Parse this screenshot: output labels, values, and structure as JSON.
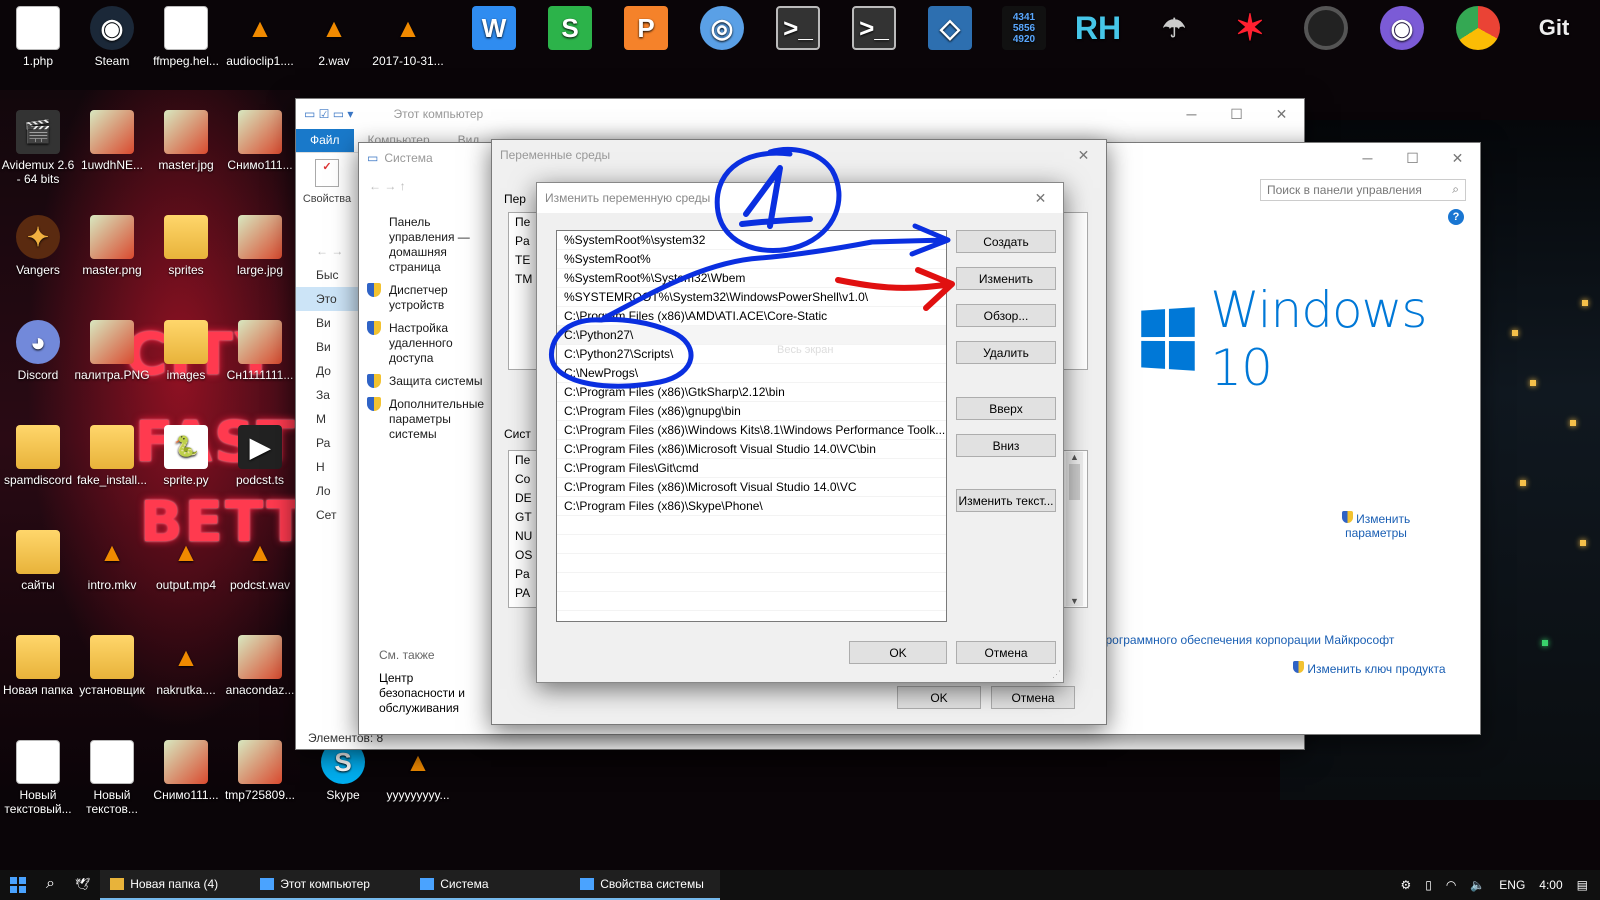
{
  "desktop": {
    "top_row": [
      {
        "label": "1.php",
        "icon": "file-icon"
      },
      {
        "label": "Steam",
        "icon": "steam-icon"
      },
      {
        "label": "ffmpeg.hel...",
        "icon": "file-icon"
      },
      {
        "label": "audioclip1....",
        "icon": "vlc-icon"
      },
      {
        "label": "2.wav",
        "icon": "vlc-icon"
      },
      {
        "label": "2017-10-31...",
        "icon": "vlc-icon"
      }
    ],
    "dock_icons": [
      "wps-writer-icon",
      "wps-spreadsheet-icon",
      "wps-presentation-icon",
      "settings-icon",
      "terminal-icon",
      "terminal-icon",
      "virtualbox-icon",
      "calculator-icon",
      "rh-icon",
      "network-icon",
      "star-icon",
      "obs-icon",
      "github-icon",
      "chrome-icon",
      "git-icon"
    ],
    "dock_text": {
      "calc": "4341\n5856\n4920",
      "rh": "RH",
      "git": "Git"
    },
    "left_icons": [
      {
        "label": "Avidemux 2.6 - 64 bits",
        "icon": "avidemux-icon"
      },
      {
        "label": "1uwdhNE...",
        "icon": "image-icon"
      },
      {
        "label": "master.jpg",
        "icon": "image-icon"
      },
      {
        "label": "Снимо111...",
        "icon": "image-icon"
      },
      {
        "label": "Vangers",
        "icon": "vangers-icon"
      },
      {
        "label": "master.png",
        "icon": "image-icon"
      },
      {
        "label": "sprites",
        "icon": "folder-icon"
      },
      {
        "label": "large.jpg",
        "icon": "image-icon"
      },
      {
        "label": "Discord",
        "icon": "discord-icon"
      },
      {
        "label": "палитра.PNG",
        "icon": "image-icon"
      },
      {
        "label": "images",
        "icon": "folder-icon"
      },
      {
        "label": "Сн1111111...",
        "icon": "image-icon"
      },
      {
        "label": "spamdiscord",
        "icon": "folder-icon"
      },
      {
        "label": "fake_install...",
        "icon": "folder-icon"
      },
      {
        "label": "sprite.py",
        "icon": "python-icon"
      },
      {
        "label": "podcst.ts",
        "icon": "video-icon"
      },
      {
        "label": "сайты",
        "icon": "folder-icon"
      },
      {
        "label": "intro.mkv",
        "icon": "vlc-icon"
      },
      {
        "label": "output.mp4",
        "icon": "vlc-icon"
      },
      {
        "label": "podcst.wav",
        "icon": "vlc-icon"
      },
      {
        "label": "Новая папка",
        "icon": "folder-icon"
      },
      {
        "label": "установщик",
        "icon": "folder-icon"
      },
      {
        "label": "nakrutka....",
        "icon": "vlc-icon"
      },
      {
        "label": "anacondaz...",
        "icon": "image-icon"
      },
      {
        "label": "Новый текстовый...",
        "icon": "file-icon"
      },
      {
        "label": "Новый текстов...",
        "icon": "file-icon"
      },
      {
        "label": "Снимо111...",
        "icon": "image-icon"
      },
      {
        "label": "tmp725809...",
        "icon": "image-icon"
      },
      {
        "label": "Skype",
        "icon": "skype-icon"
      },
      {
        "label": "yyyyyyyyy...",
        "icon": "vlc-icon"
      }
    ]
  },
  "explorer": {
    "title": "Этот компьютер",
    "tabs": [
      "Файл",
      "Компьютер",
      "Вид"
    ],
    "properties_label": "Свойства",
    "nav_items": [
      "Быс",
      "Это",
      "Ви",
      "Ви",
      "До",
      "За",
      "М",
      "Ра",
      "Н",
      "Ло",
      "Сет"
    ],
    "status": "Элементов: 8"
  },
  "system": {
    "title": "Система",
    "left_links": [
      {
        "label": "Панель управления — домашняя страница",
        "shield": false
      },
      {
        "label": "Диспетчер устройств",
        "shield": true
      },
      {
        "label": "Настройка удаленного доступа",
        "shield": true
      },
      {
        "label": "Защита системы",
        "shield": true
      },
      {
        "label": "Дополнительные параметры системы",
        "shield": true
      }
    ],
    "see_also": "См. также",
    "security_center": "Центр безопасности и обслуживания",
    "search_placeholder": "Поиск в панели управления",
    "windows_brand": "Windows 10",
    "change_params": "Изменить параметры",
    "ms_software": "программного обеспечения корпорации Майкрософт",
    "change_key": "Изменить ключ продукта"
  },
  "env_dialog": {
    "title": "Переменные среды",
    "user_group": "Пер",
    "user_vars": [
      "Пе",
      "Pa",
      "TE",
      "TM"
    ],
    "system_group": "Сист",
    "system_vars": [
      "Пе",
      "Co",
      "DE",
      "GT",
      "NU",
      "OS",
      "Pa",
      "PA"
    ],
    "ok": "OK",
    "cancel": "Отмена"
  },
  "edit_dialog": {
    "title": "Изменить переменную среды",
    "paths": [
      "%SystemRoot%\\system32",
      "%SystemRoot%",
      "%SystemRoot%\\System32\\Wbem",
      "%SYSTEMROOT%\\System32\\WindowsPowerShell\\v1.0\\",
      "C:\\Program Files (x86)\\AMD\\ATI.ACE\\Core-Static",
      "C:\\Python27\\",
      "C:\\Python27\\Scripts\\",
      "C:\\NewProgs\\",
      "C:\\Program Files (x86)\\GtkSharp\\2.12\\bin",
      "C:\\Program Files (x86)\\gnupg\\bin",
      "C:\\Program Files (x86)\\Windows Kits\\8.1\\Windows Performance Toolk...",
      "C:\\Program Files (x86)\\Microsoft Visual Studio 14.0\\VC\\bin",
      "C:\\Program Files\\Git\\cmd",
      "C:\\Program Files (x86)\\Microsoft Visual Studio 14.0\\VC",
      "C:\\Program Files (x86)\\Skype\\Phone\\"
    ],
    "ghost_text": "Весь экран",
    "buttons": {
      "create": "Создать",
      "edit": "Изменить",
      "browse": "Обзор...",
      "delete": "Удалить",
      "up": "Вверх",
      "down": "Вниз",
      "edit_text": "Изменить текст...",
      "ok": "OK",
      "cancel": "Отмена"
    }
  },
  "annotation": {
    "number": "1",
    "ring_color": "#0a2fe0",
    "arrow_color": "#e01010"
  },
  "taskbar": {
    "items": [
      {
        "label": "Новая папка (4)",
        "icon": "folder-icon"
      },
      {
        "label": "Этот компьютер",
        "icon": "computer-icon"
      },
      {
        "label": "Система",
        "icon": "system-icon"
      },
      {
        "label": "Свойства системы",
        "icon": "system-properties-icon"
      }
    ],
    "lang": "ENG",
    "time": "4:00"
  }
}
